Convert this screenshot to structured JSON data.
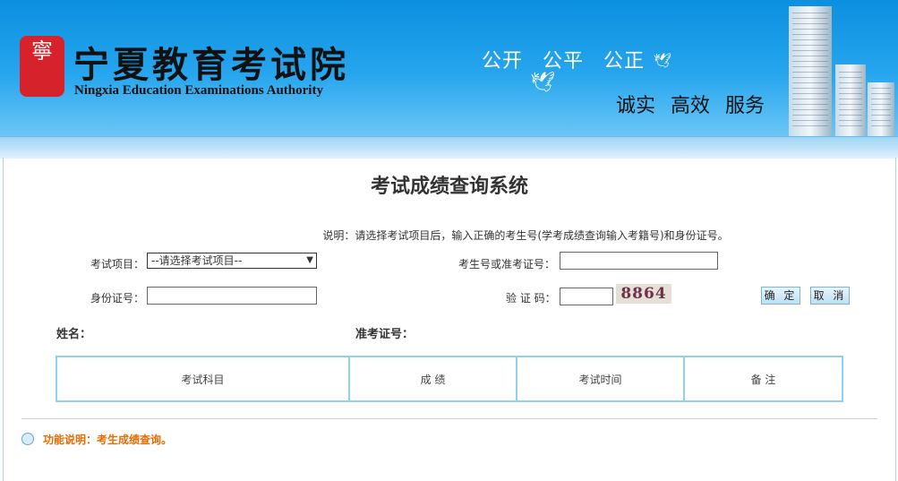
{
  "header": {
    "logo_seal": "寧",
    "logo_cn": "宁夏教育考试院",
    "logo_en": "Ningxia Education Examinations Authority",
    "slogan_top": "公开 公平 公正",
    "slogan_bottom": "诚实 高效 服务"
  },
  "page": {
    "title": "考试成绩查询系统",
    "description": "说明：请选择考试项目后，输入正确的考生号(学考成绩查询输入考籍号)和身份证号。"
  },
  "form": {
    "exam_item_label": "考试项目：",
    "exam_item_selected": "--请选择考试项目--",
    "candidate_no_label": "考生号或准考证号：",
    "id_card_label": "身份证号：",
    "captcha_label": "验 证 码：",
    "captcha_code": "8864",
    "confirm_label": "确 定",
    "cancel_label": "取 消"
  },
  "result": {
    "name_label": "姓名：",
    "admission_label": "准考证号："
  },
  "table": {
    "headers": [
      "考试科目",
      "成 绩",
      "考试时间",
      "备 注"
    ]
  },
  "footer": {
    "function_note": "功能说明：考生成绩查询。"
  }
}
